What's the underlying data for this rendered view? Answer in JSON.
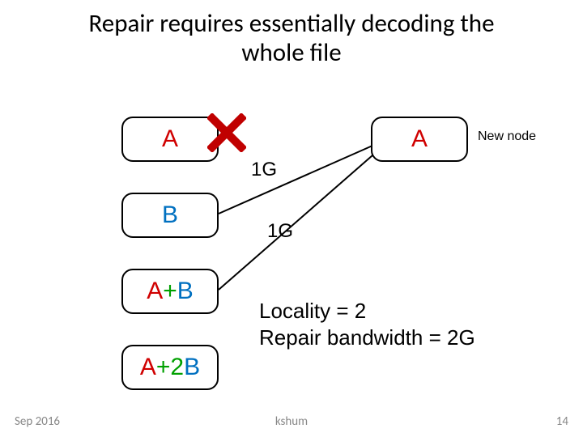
{
  "title_line1": "Repair requires essentially decoding the",
  "title_line2": "whole file",
  "nodes": {
    "A_left": "A",
    "B": "B",
    "AplusB_A": "A",
    "AplusB_plus": "+",
    "AplusB_B": "B",
    "Aplus2B_A": "A",
    "Aplus2B_plus": "+",
    "Aplus2B_2": "2",
    "Aplus2B_B": "B",
    "A_right": "A"
  },
  "edge_labels": {
    "top": "1G",
    "bottom": "1G"
  },
  "new_node_label": "New node",
  "caption_line1": "Locality = 2",
  "caption_line2": "Repair bandwidth = 2G",
  "footer": {
    "left": "Sep 2016",
    "center": "kshum",
    "right": "14"
  },
  "chart_data": {
    "type": "diagram",
    "title": "Repair requires essentially decoding the whole file",
    "nodes": [
      {
        "id": "A_failed",
        "label": "A",
        "status": "failed"
      },
      {
        "id": "B",
        "label": "B"
      },
      {
        "id": "A+B",
        "label": "A+B"
      },
      {
        "id": "A+2B",
        "label": "A+2B"
      },
      {
        "id": "A_new",
        "label": "A",
        "status": "new"
      }
    ],
    "edges": [
      {
        "from": "B",
        "to": "A_new",
        "label": "1G"
      },
      {
        "from": "A+B",
        "to": "A_new",
        "label": "1G"
      }
    ],
    "annotations": {
      "locality": 2,
      "repair_bandwidth": "2G"
    }
  }
}
